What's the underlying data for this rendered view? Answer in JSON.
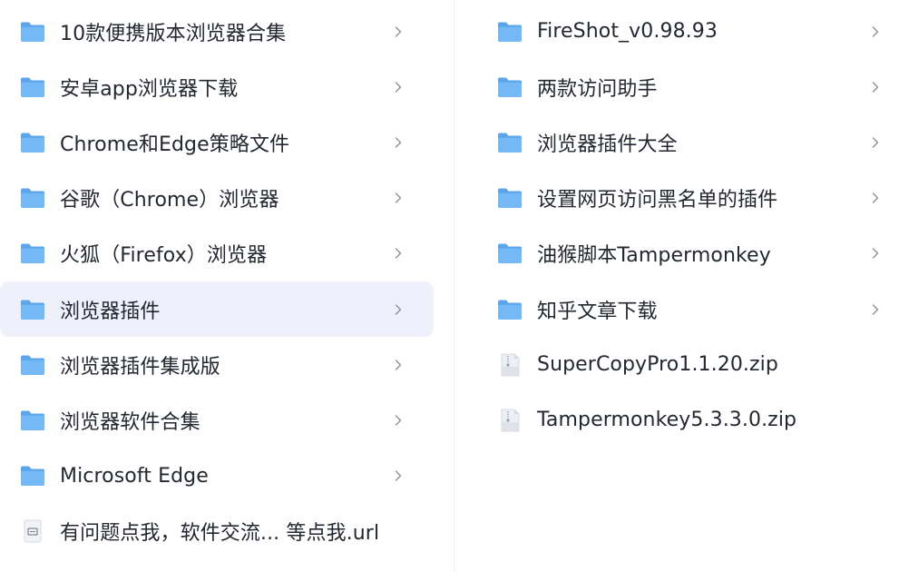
{
  "left_items": [
    {
      "label": "10款便携版本浏览器合集",
      "icon": "folder-icon",
      "chevron": true,
      "selected": false
    },
    {
      "label": "安卓app浏览器下载",
      "icon": "folder-icon",
      "chevron": true,
      "selected": false
    },
    {
      "label": "Chrome和Edge策略文件",
      "icon": "folder-icon",
      "chevron": true,
      "selected": false
    },
    {
      "label": "谷歌（Chrome）浏览器",
      "icon": "folder-icon",
      "chevron": true,
      "selected": false
    },
    {
      "label": "火狐（Firefox）浏览器",
      "icon": "folder-icon",
      "chevron": true,
      "selected": false
    },
    {
      "label": "浏览器插件",
      "icon": "folder-icon",
      "chevron": true,
      "selected": true
    },
    {
      "label": "浏览器插件集成版",
      "icon": "folder-icon",
      "chevron": true,
      "selected": false
    },
    {
      "label": "浏览器软件合集",
      "icon": "folder-icon",
      "chevron": true,
      "selected": false
    },
    {
      "label": "Microsoft Edge",
      "icon": "folder-icon",
      "chevron": true,
      "selected": false
    },
    {
      "label": "有问题点我，软件交流... 等点我.url",
      "icon": "url-file-icon",
      "chevron": false,
      "selected": false
    }
  ],
  "right_items": [
    {
      "label": "FireShot_v0.98.93",
      "icon": "folder-icon",
      "chevron": true
    },
    {
      "label": "两款访问助手",
      "icon": "folder-icon",
      "chevron": true
    },
    {
      "label": "浏览器插件大全",
      "icon": "folder-icon",
      "chevron": true
    },
    {
      "label": "设置网页访问黑名单的插件",
      "icon": "folder-icon",
      "chevron": true
    },
    {
      "label": "油猴脚本Tampermonkey",
      "icon": "folder-icon",
      "chevron": true
    },
    {
      "label": "知乎文章下载",
      "icon": "folder-icon",
      "chevron": true
    },
    {
      "label": "SuperCopyPro1.1.20.zip",
      "icon": "zip-file-icon",
      "chevron": false
    },
    {
      "label": "Tampermonkey5.3.3.0.zip",
      "icon": "zip-file-icon",
      "chevron": false
    }
  ],
  "colors": {
    "folder": "#5aa5ec",
    "folder_front": "#74b9f5",
    "selected_bg": "#eef1fc",
    "chevron": "#8a8f99",
    "text": "#23272f"
  }
}
